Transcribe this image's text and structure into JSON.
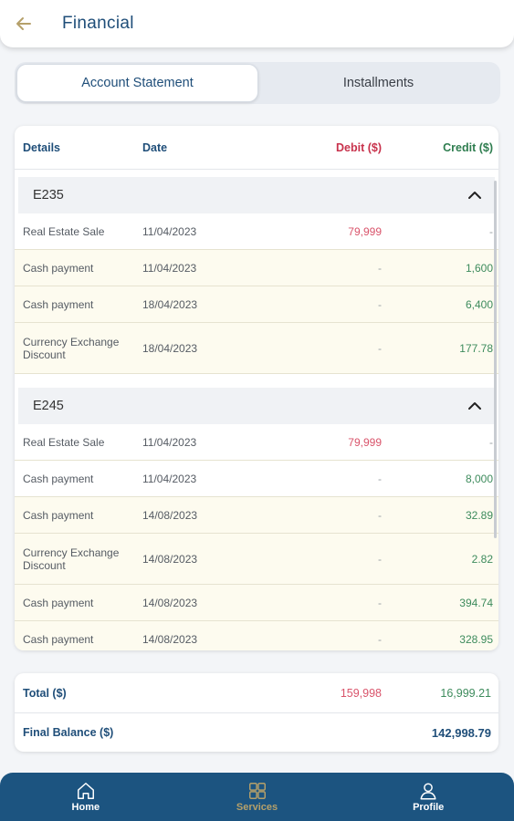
{
  "header": {
    "title": "Financial"
  },
  "tabs": [
    {
      "label": "Account Statement",
      "active": true
    },
    {
      "label": "Installments",
      "active": false
    }
  ],
  "table": {
    "columns": {
      "details": "Details",
      "date": "Date",
      "debit": "Debit ($)",
      "credit": "Credit ($)"
    },
    "groups": [
      {
        "id": "E235",
        "rows": [
          {
            "details": "Real Estate Sale",
            "date": "11/04/2023",
            "debit": "79,999",
            "credit": "-"
          },
          {
            "details": "Cash payment",
            "date": "11/04/2023",
            "debit": "-",
            "credit": "1,600"
          },
          {
            "details": "Cash payment",
            "date": "18/04/2023",
            "debit": "-",
            "credit": "6,400"
          },
          {
            "details": "Currency Exchange Discount",
            "date": "18/04/2023",
            "debit": "-",
            "credit": "177.78"
          }
        ]
      },
      {
        "id": "E245",
        "rows": [
          {
            "details": "Real Estate Sale",
            "date": "11/04/2023",
            "debit": "79,999",
            "credit": "-"
          },
          {
            "details": "Cash payment",
            "date": "11/04/2023",
            "debit": "-",
            "credit": "8,000"
          },
          {
            "details": "Cash payment",
            "date": "14/08/2023",
            "debit": "-",
            "credit": "32.89"
          },
          {
            "details": "Currency Exchange Discount",
            "date": "14/08/2023",
            "debit": "-",
            "credit": "2.82"
          },
          {
            "details": "Cash payment",
            "date": "14/08/2023",
            "debit": "-",
            "credit": "394.74"
          },
          {
            "details": "Cash payment",
            "date": "14/08/2023",
            "debit": "-",
            "credit": "328.95"
          }
        ]
      }
    ]
  },
  "totals": {
    "total_label": "Total ($)",
    "total_debit": "159,998",
    "total_credit": "16,999.21",
    "final_label": "Final Balance ($)",
    "final_value": "142,998.79"
  },
  "nav": {
    "home": "Home",
    "services": "Services",
    "profile": "Profile"
  },
  "colors": {
    "primary": "#1f4e79",
    "debit": "#d9546b",
    "credit": "#3d8b5c",
    "accent": "#b5a06a",
    "nav": "#1c5480"
  },
  "icons": {
    "back": "arrow-left-icon",
    "collapse": "chevron-up-icon",
    "home": "home-icon",
    "services": "grid-icon",
    "profile": "user-icon"
  }
}
